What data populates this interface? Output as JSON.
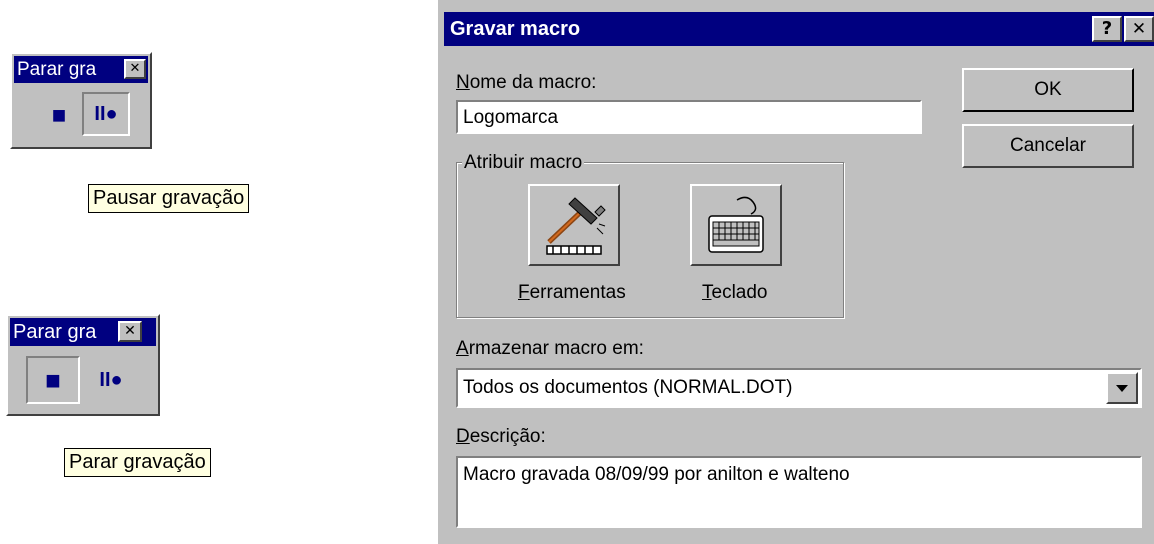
{
  "toolbar1": {
    "title": "Parar gra",
    "close_glyph": "✕",
    "stop_glyph": "■",
    "pause_glyph": "II●"
  },
  "tooltip1": {
    "text": "Pausar gravação"
  },
  "toolbar2": {
    "title": "Parar gra",
    "close_glyph": "✕",
    "stop_glyph": "■",
    "pause_glyph": "II●"
  },
  "tooltip2": {
    "text": "Parar gravação"
  },
  "dialog": {
    "title": "Gravar macro",
    "help_glyph": "?",
    "close_glyph": "✕",
    "name_label_underline": "N",
    "name_label_rest": "ome da macro:",
    "name_value": "Logomarca",
    "ok_label": "OK",
    "cancel_label": "Cancelar",
    "assign_group_label": "Atribuir macro",
    "tools_label_underline": "F",
    "tools_label_rest": "erramentas",
    "keyboard_label_underline": "T",
    "keyboard_label_rest": "eclado",
    "store_label_underline": "A",
    "store_label_rest": "rmazenar macro em:",
    "store_value": "Todos os documentos (NORMAL.DOT)",
    "desc_label_underline": "D",
    "desc_label_rest": "escrição:",
    "desc_value": "Macro gravada 08/09/99 por anilton e walteno"
  },
  "icons": {
    "hammer": "hammer-icon",
    "keyboard": "keyboard-icon",
    "dropdown": "chevron-down-icon"
  },
  "colors": {
    "title_bar": "#000080",
    "face": "#c0c0c0",
    "tooltip_bg": "#ffffe1"
  }
}
